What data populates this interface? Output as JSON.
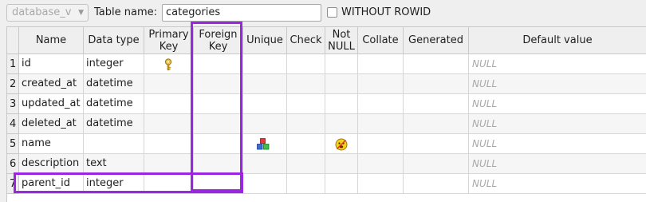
{
  "toolbar": {
    "schema_value": "database_v",
    "table_name_label": "Table name:",
    "table_name_value": "categories",
    "without_rowid_label": "WITHOUT ROWID"
  },
  "columns": {
    "name": "Name",
    "data_type": "Data type",
    "primary_key": "Primary Key",
    "foreign_key": "Foreign Key",
    "unique": "Unique",
    "check": "Check",
    "not_null": "Not NULL",
    "collate": "Collate",
    "generated": "Generated",
    "default_value": "Default value"
  },
  "rows": [
    {
      "num": "1",
      "name": "id",
      "type": "integer",
      "default": "NULL"
    },
    {
      "num": "2",
      "name": "created_at",
      "type": "datetime",
      "default": "NULL"
    },
    {
      "num": "3",
      "name": "updated_at",
      "type": "datetime",
      "default": "NULL"
    },
    {
      "num": "4",
      "name": "deleted_at",
      "type": "datetime",
      "default": "NULL"
    },
    {
      "num": "5",
      "name": "name",
      "type": "",
      "default": "NULL"
    },
    {
      "num": "6",
      "name": "description",
      "type": "text",
      "default": "NULL"
    },
    {
      "num": "7",
      "name": "parent_id",
      "type": "integer",
      "default": "NULL"
    }
  ],
  "icons": {
    "primary_key": "key-icon",
    "unique": "unique-blocks-icon",
    "not_null": "not-null-icon"
  },
  "colors": {
    "highlight": "#9b25e0",
    "null_text": "#a9a9a9"
  }
}
